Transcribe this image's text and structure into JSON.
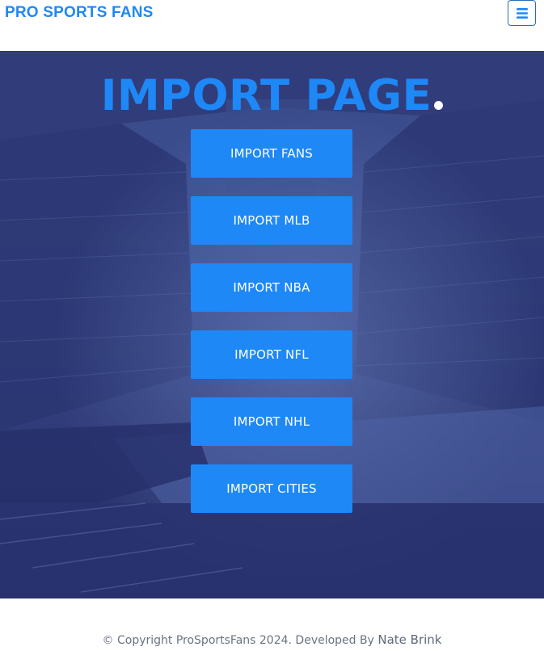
{
  "header": {
    "brand": "PRO SPORTS FANS",
    "menu_icon": "hamburger-menu-icon"
  },
  "hero": {
    "title": "IMPORT PAGE",
    "buttons": [
      {
        "label": "IMPORT FANS"
      },
      {
        "label": "IMPORT MLB"
      },
      {
        "label": "IMPORT NBA"
      },
      {
        "label": "IMPORT NFL"
      },
      {
        "label": "IMPORT NHL"
      },
      {
        "label": "IMPORT CITIES"
      }
    ]
  },
  "footer": {
    "copyright": "© Copyright ProSportsFans 2024. Developed By",
    "developer": "Nate Brink"
  },
  "colors": {
    "accent": "#1e88f7",
    "overlay": "#2d3a78",
    "footer_text": "#6b7380"
  }
}
